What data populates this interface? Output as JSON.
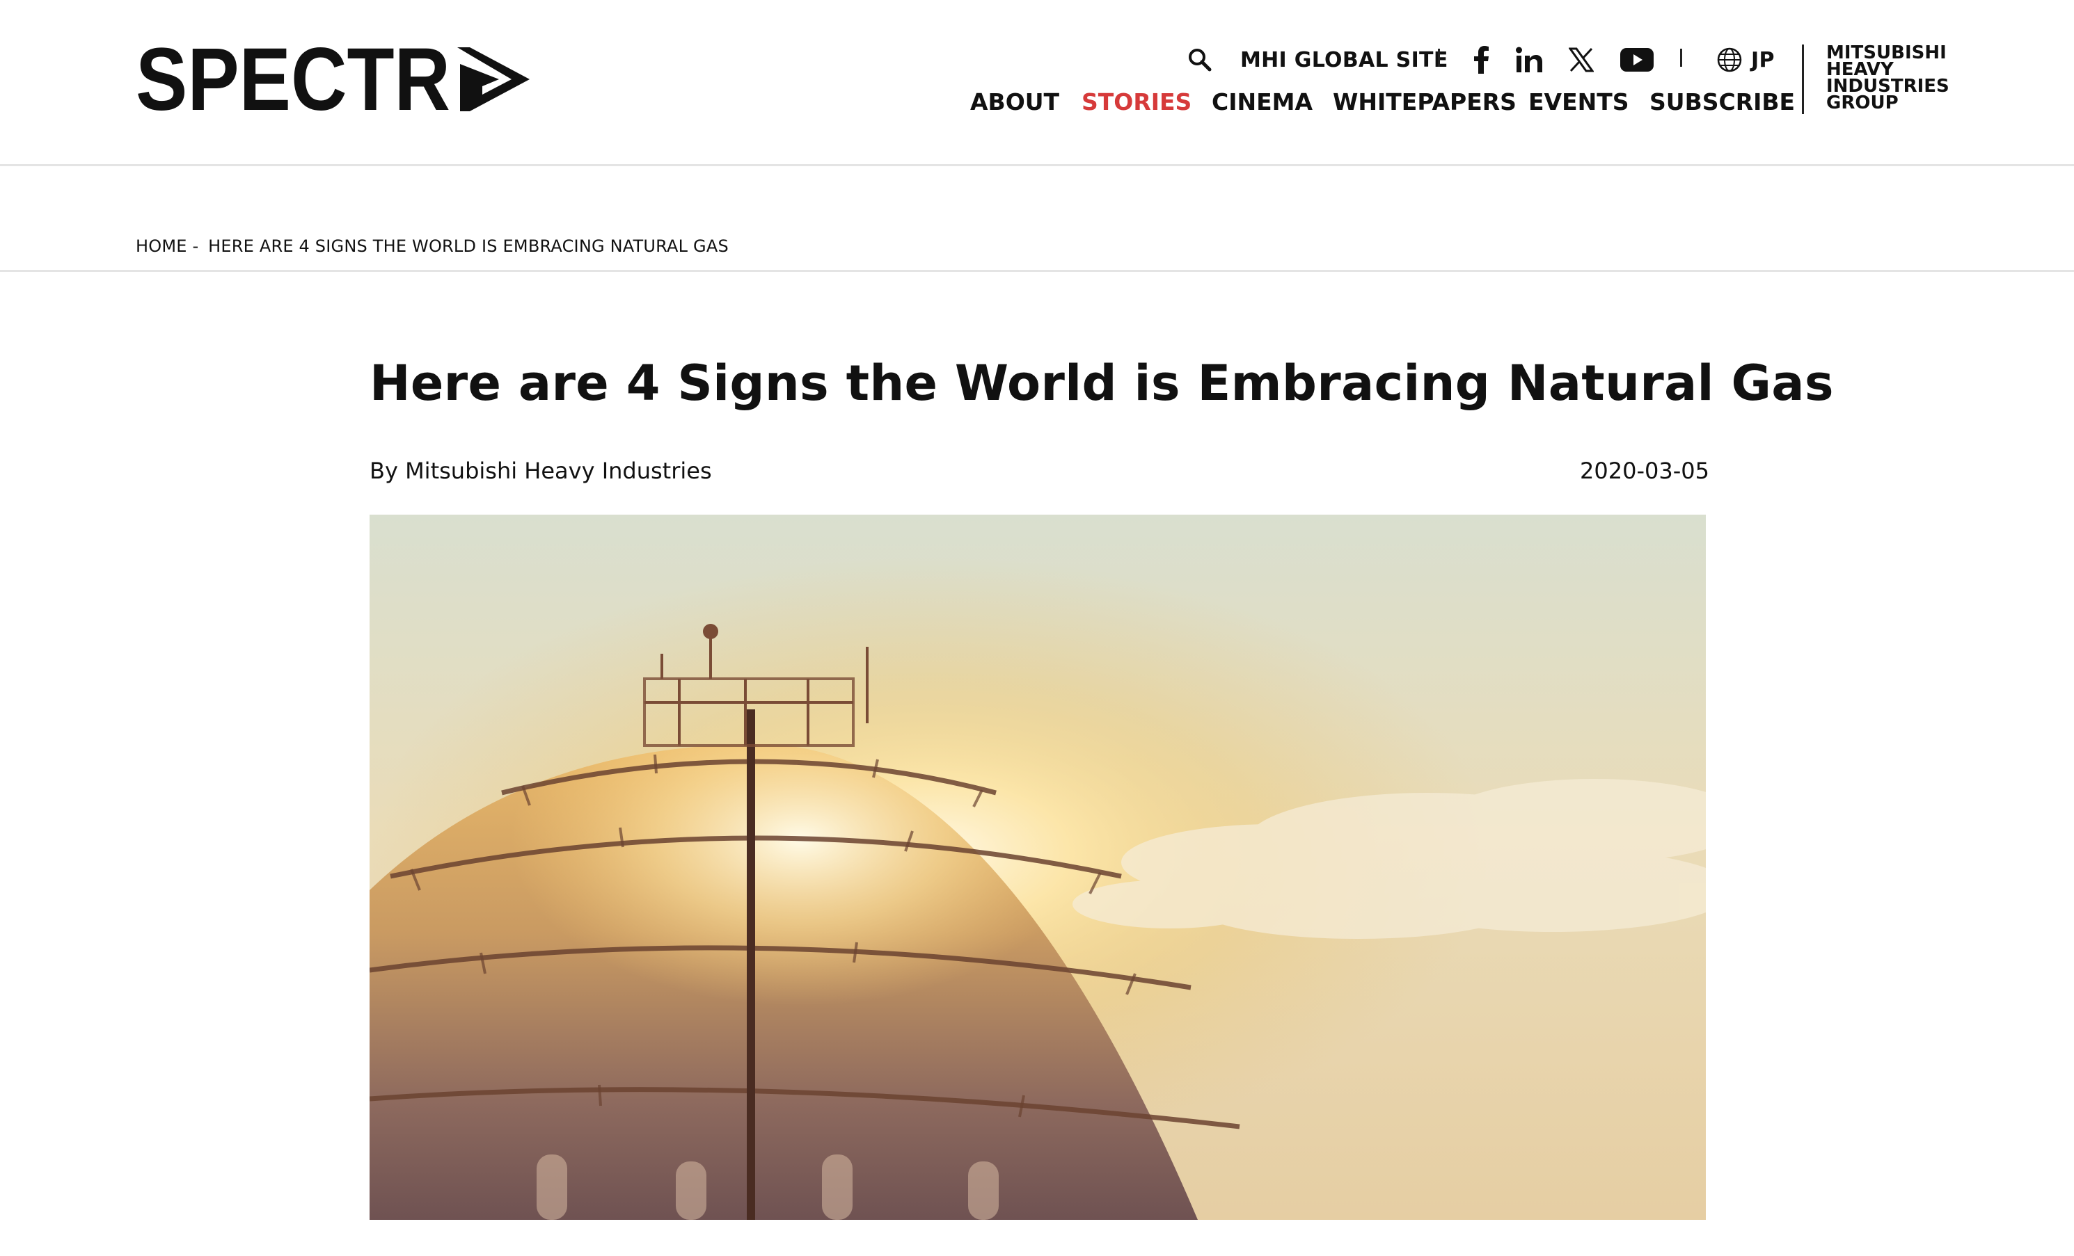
{
  "brand": {
    "logo_text": "SPECTRA",
    "group_name": "MITSUBISHI HEAVY INDUSTRIES GROUP",
    "group_lines": [
      "MITSUBISHI",
      "HEAVY",
      "INDUSTRIES",
      "GROUP"
    ]
  },
  "utility": {
    "global_site_label": "MHI GLOBAL SITE",
    "language_label": "JP",
    "icons": [
      "search-icon",
      "facebook-icon",
      "linkedin-icon",
      "x-icon",
      "youtube-icon",
      "globe-icon"
    ]
  },
  "nav": [
    {
      "label": "ABOUT",
      "active": false
    },
    {
      "label": "STORIES",
      "active": true
    },
    {
      "label": "CINEMA",
      "active": false
    },
    {
      "label": "WHITEPAPERS",
      "active": false
    },
    {
      "label": "EVENTS",
      "active": false
    },
    {
      "label": "SUBSCRIBE",
      "active": false
    }
  ],
  "breadcrumb": {
    "home": "HOME",
    "separator": " - ",
    "current": "HERE ARE 4 SIGNS THE WORLD IS EMBRACING NATURAL GAS"
  },
  "article": {
    "title": "Here are 4 Signs the World is Embracing Natural Gas",
    "byline": "By Mitsubishi Heavy Industries",
    "date": "2020-03-05"
  },
  "colors": {
    "accent": "#d63a3a",
    "text": "#111111",
    "rule": "#e4e4e4"
  }
}
